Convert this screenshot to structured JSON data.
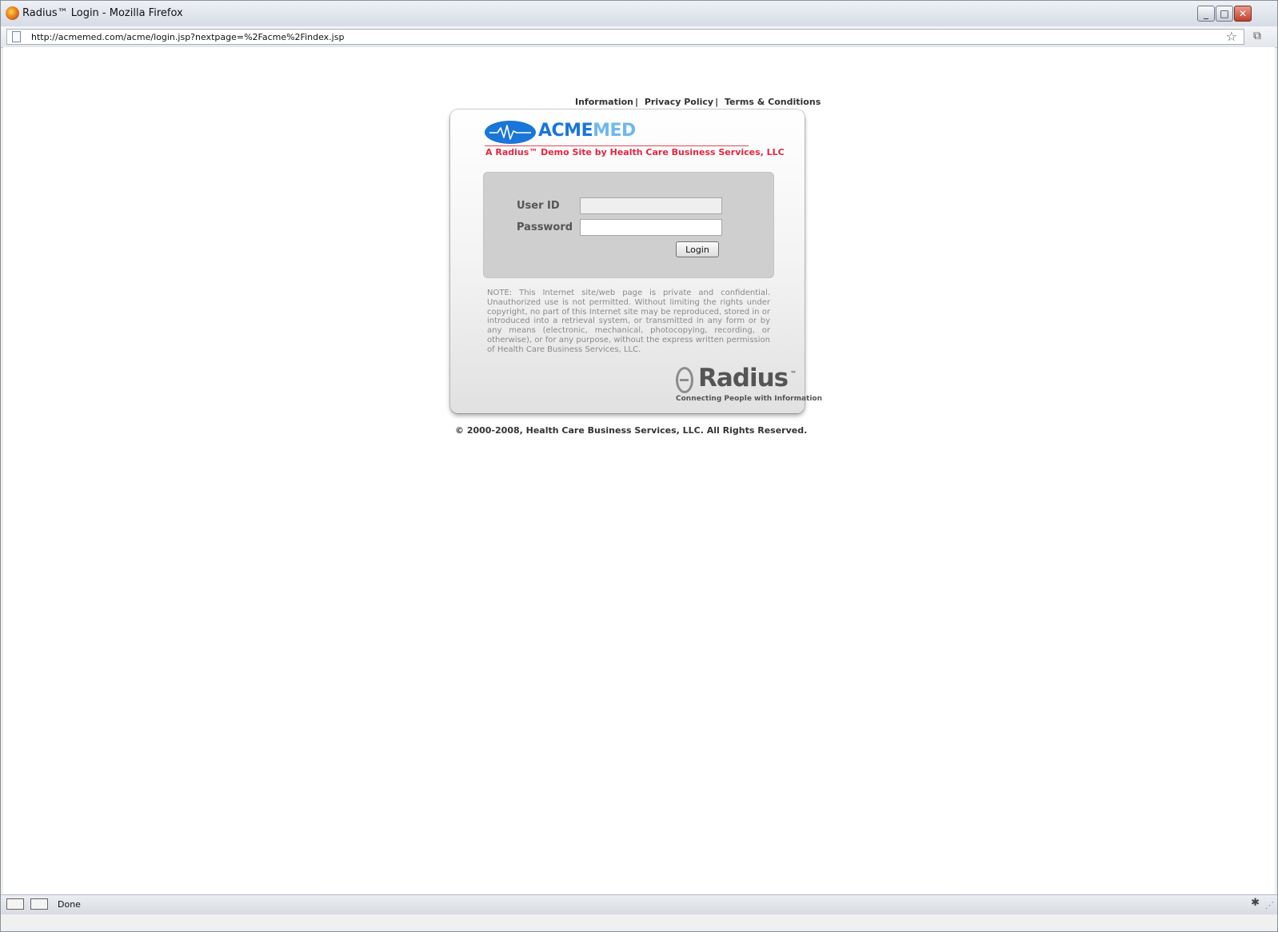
{
  "window": {
    "title": "Radius™ Login - Mozilla Firefox",
    "minimize": "_",
    "maximize": "□",
    "close": "✕"
  },
  "navbar": {
    "url": "http://acmemed.com/acme/login.jsp?nextpage=%2Facme%2Findex.jsp",
    "bookmark_icon": "star-icon"
  },
  "page": {
    "links": [
      "Information",
      "Privacy Policy",
      "Terms & Conditions"
    ],
    "link_separator": "|",
    "logo": {
      "acme": "ACME",
      "med": "MED",
      "colors": {
        "acme": "#1a76d8",
        "med": "#6fb8ef"
      }
    },
    "tagline": "A Radius™ Demo Site by Health Care Business Services, LLC",
    "form": {
      "userid_label": "User ID",
      "userid_value": "",
      "password_label": "Password",
      "password_value": "",
      "login_button": "Login"
    },
    "note": "NOTE: This Internet site/web page is private and confidential. Unauthorized use is not permitted. Without limiting the rights under copyright, no part of this Internet site may be reproduced, stored in or introduced into a retrieval system, or transmitted in any form or by any means (electronic, mechanical, photocopying, recording, or otherwise), or for any purpose, without the express written permission of Health Care Business Services, LLC.",
    "radius_logo": {
      "word": "Radius",
      "tm": "™",
      "tagline": "Connecting People with Information"
    },
    "copyright": "© 2000-2008, Health Care Business Services, LLC. All Rights Reserved."
  },
  "statusbar": {
    "status": "Done"
  }
}
